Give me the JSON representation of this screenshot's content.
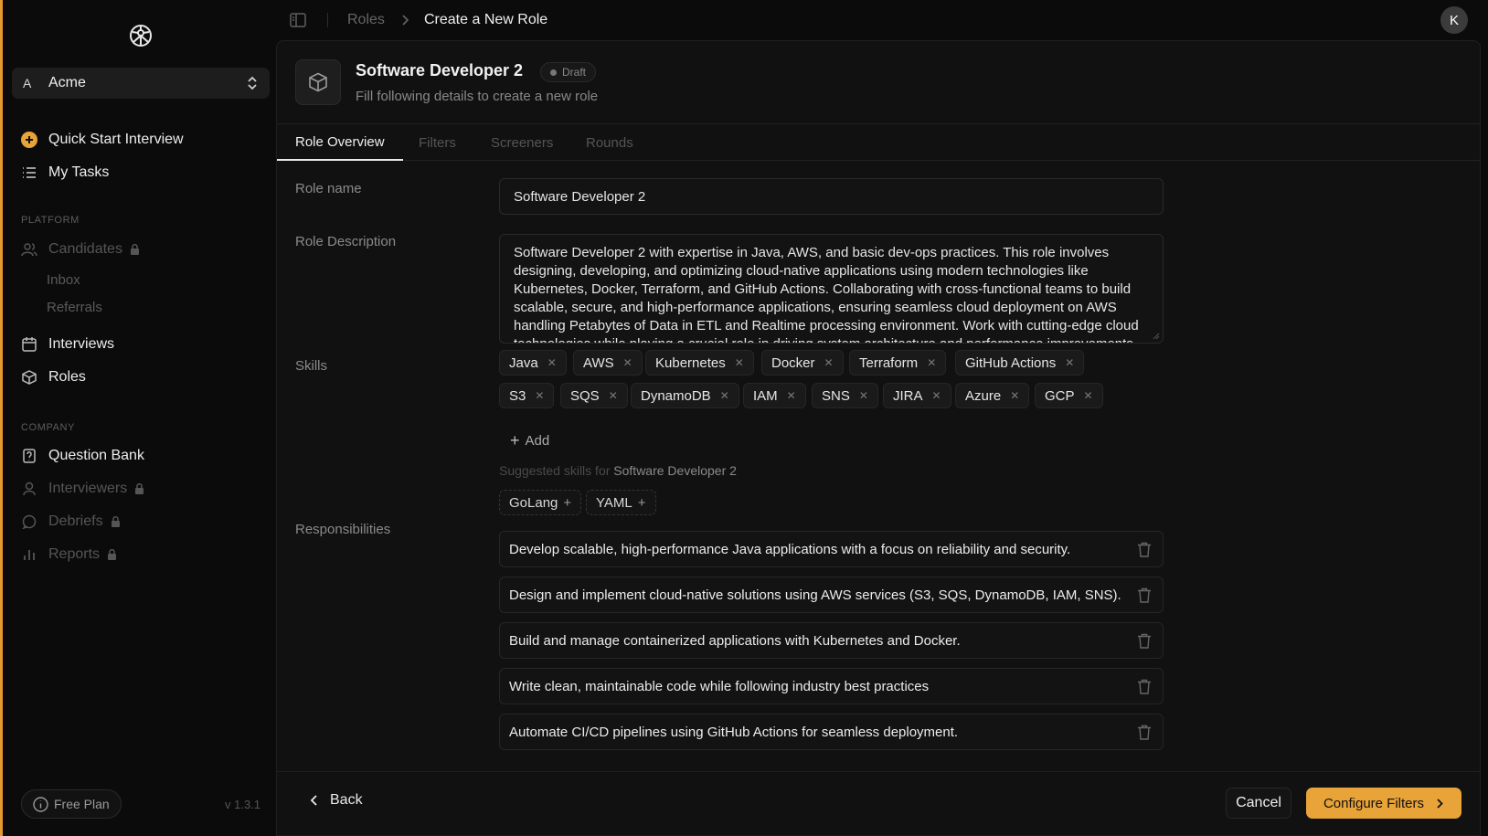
{
  "sidebar": {
    "org": {
      "letter": "A",
      "name": "Acme"
    },
    "quick_start": "Quick Start Interview",
    "my_tasks": "My Tasks",
    "platform_label": "PLATFORM",
    "candidates": "Candidates",
    "inbox": "Inbox",
    "referrals": "Referrals",
    "interviews": "Interviews",
    "roles": "Roles",
    "company_label": "COMPANY",
    "question_bank": "Question Bank",
    "interviewers": "Interviewers",
    "debriefs": "Debriefs",
    "reports": "Reports",
    "free_plan": "Free Plan",
    "version": "v 1.3.1"
  },
  "topbar": {
    "breadcrumb_parent": "Roles",
    "breadcrumb_current": "Create a New Role",
    "avatar_letter": "K"
  },
  "header": {
    "title": "Software Developer 2",
    "status": "Draft",
    "subtitle": "Fill following details to create a new role"
  },
  "tabs": [
    "Role Overview",
    "Filters",
    "Screeners",
    "Rounds"
  ],
  "form": {
    "role_name_label": "Role name",
    "role_name_value": "Software Developer 2",
    "description_label": "Role Description",
    "description_value": "Software Developer 2 with expertise in Java, AWS, and basic dev-ops practices. This role involves designing, developing, and optimizing cloud-native applications using modern technologies like Kubernetes, Docker, Terraform, and GitHub Actions. Collaborating with cross-functional teams to build scalable, secure, and high-performance applications, ensuring seamless cloud deployment on AWS handling Petabytes of Data in ETL and Realtime processing environment. Work with cutting-edge cloud technologies while playing a crucial role in driving system architecture and performance improvements.",
    "skills_label": "Skills",
    "skills": [
      "Java",
      "AWS",
      "Kubernetes",
      "Docker",
      "Terraform",
      "GitHub Actions",
      "S3",
      "SQS",
      "DynamoDB",
      "IAM",
      "SNS",
      "JIRA",
      "Azure",
      "GCP"
    ],
    "add_label": "Add",
    "suggested_prefix": "Suggested skills for",
    "suggested_role": "Software Developer 2",
    "suggested_skills": [
      "GoLang",
      "YAML"
    ],
    "responsibilities_label": "Responsibilities",
    "responsibilities": [
      "Develop scalable, high-performance Java applications with a focus on reliability and security.",
      "Design and implement cloud-native solutions using AWS services (S3, SQS, DynamoDB, IAM, SNS).",
      "Build and manage containerized applications with Kubernetes and Docker.",
      "Write clean, maintainable code while following industry best practices",
      "Automate CI/CD pipelines using GitHub Actions for seamless deployment."
    ]
  },
  "footer": {
    "back": "Back",
    "cancel": "Cancel",
    "configure": "Configure Filters"
  },
  "colors": {
    "accent": "#e8a339",
    "background": "#0b0b0b",
    "panel": "#111111"
  }
}
